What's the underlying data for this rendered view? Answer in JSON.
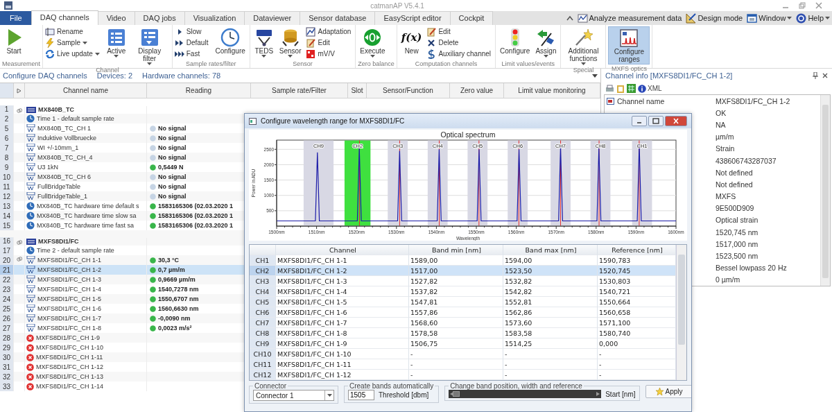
{
  "window": {
    "title": "catmanAP V5.4.1"
  },
  "tabs": [
    {
      "label": "File",
      "kind": "file",
      "selected": false
    },
    {
      "label": "DAQ channels",
      "kind": "tab",
      "selected": true
    },
    {
      "label": "Video",
      "kind": "tab",
      "selected": false
    },
    {
      "label": "DAQ jobs",
      "kind": "tab",
      "selected": false
    },
    {
      "label": "Visualization",
      "kind": "tab",
      "selected": false
    },
    {
      "label": "Dataviewer",
      "kind": "tab",
      "selected": false
    },
    {
      "label": "Sensor database",
      "kind": "tab",
      "selected": false
    },
    {
      "label": "EasyScript editor",
      "kind": "tab",
      "selected": false
    },
    {
      "label": "Cockpit",
      "kind": "tab",
      "selected": false
    }
  ],
  "quick_commands": [
    {
      "label": "Analyze measurement data",
      "dropdown": false
    },
    {
      "label": "Design mode",
      "dropdown": false
    },
    {
      "label": "Window",
      "dropdown": true
    },
    {
      "label": "Help",
      "dropdown": true
    }
  ],
  "ribbon": {
    "groups": [
      {
        "label": "Measurement",
        "columns": [
          {
            "kind": "large",
            "items": [
              {
                "label": "Start",
                "dropdown": false,
                "selected": false
              }
            ]
          }
        ]
      },
      {
        "label": "Channel",
        "columns": [
          {
            "kind": "small",
            "items": [
              {
                "label": "Rename",
                "dropdown": false
              },
              {
                "label": "Sample",
                "dropdown": true
              },
              {
                "label": "Live update",
                "dropdown": true
              }
            ]
          },
          {
            "kind": "large",
            "items": [
              {
                "label": "Active",
                "dropdown": true,
                "selected": false
              },
              {
                "label": "Display filter",
                "dropdown": true,
                "selected": false
              }
            ]
          }
        ]
      },
      {
        "label": "Sample rates/filter",
        "columns": [
          {
            "kind": "small",
            "items": [
              {
                "label": "Slow",
                "dropdown": false
              },
              {
                "label": "Default",
                "dropdown": false
              },
              {
                "label": "Fast",
                "dropdown": false
              }
            ]
          },
          {
            "kind": "large",
            "items": [
              {
                "label": "Configure",
                "dropdown": false,
                "selected": false
              }
            ]
          }
        ]
      },
      {
        "label": "Sensor",
        "columns": [
          {
            "kind": "large",
            "items": [
              {
                "label": "TEDS",
                "dropdown": true,
                "selected": false
              },
              {
                "label": "Sensor",
                "dropdown": true,
                "selected": false
              }
            ]
          },
          {
            "kind": "small",
            "items": [
              {
                "label": "Adaptation",
                "dropdown": false
              },
              {
                "label": "Edit",
                "dropdown": false
              },
              {
                "label": "mV/V",
                "dropdown": false
              }
            ]
          }
        ]
      },
      {
        "label": "Zero balance",
        "columns": [
          {
            "kind": "large",
            "items": [
              {
                "label": "Execute",
                "dropdown": true,
                "selected": false
              }
            ]
          }
        ]
      },
      {
        "label": "Computation channels",
        "columns": [
          {
            "kind": "large",
            "items": [
              {
                "label": "New",
                "icon_text": "f(x)",
                "dropdown": false,
                "selected": false
              }
            ]
          },
          {
            "kind": "small",
            "items": [
              {
                "label": "Edit",
                "dropdown": false
              },
              {
                "label": "Delete",
                "dropdown": false
              },
              {
                "label": "Auxiliary channel",
                "dropdown": false
              }
            ]
          }
        ]
      },
      {
        "label": "Limit values/events",
        "columns": [
          {
            "kind": "large",
            "items": [
              {
                "label": "Configure",
                "dropdown": false,
                "selected": false
              },
              {
                "label": "Assign",
                "dropdown": true,
                "selected": false
              }
            ]
          }
        ]
      },
      {
        "label": "Special",
        "columns": [
          {
            "kind": "large",
            "items": [
              {
                "label": "Additional functions",
                "dropdown": true,
                "selected": false
              }
            ]
          }
        ]
      },
      {
        "label": "MXFS optics",
        "columns": [
          {
            "kind": "large",
            "items": [
              {
                "label": "Configure ranges",
                "dropdown": false,
                "selected": true
              }
            ]
          }
        ]
      }
    ]
  },
  "status_line": {
    "title": "Configure DAQ channels",
    "devices": "Devices: 2",
    "hardware_channels": "Hardware channels: 78"
  },
  "channel_table": {
    "columns": [
      "Channel name",
      "Reading",
      "Sample rate/Filter",
      "Slot",
      "Sensor/Function",
      "Zero value",
      "Limit value monitoring"
    ],
    "rows": [
      {
        "number": "1",
        "kind": "device",
        "name": "MX840B_TC",
        "linked": true,
        "selected": false
      },
      {
        "number": "2",
        "kind": "time",
        "name": "Time 1 - default sample rate",
        "linked": false,
        "selected": false
      },
      {
        "number": "5",
        "kind": "channel",
        "name": "MX840B_TC_CH 1",
        "color": "#c6d4e4",
        "reading": "No signal",
        "linked": false,
        "selected": false
      },
      {
        "number": "6",
        "kind": "channel",
        "name": "Induktive Vollbruecke",
        "color": "#c6d4e4",
        "reading": "No signal",
        "linked": false,
        "selected": false
      },
      {
        "number": "7",
        "kind": "channel",
        "name": "WI +/-10mm_1",
        "color": "#c6d4e4",
        "reading": "No signal",
        "linked": false,
        "selected": false
      },
      {
        "number": "8",
        "kind": "channel",
        "name": "MX840B_TC_CH_4",
        "color": "#c6d4e4",
        "reading": "No signal",
        "linked": false,
        "selected": false
      },
      {
        "number": "9",
        "kind": "channel",
        "name": "U3 1kN",
        "color": "#39b54a",
        "reading": "0,5449 N",
        "linked": false,
        "selected": false
      },
      {
        "number": "10",
        "kind": "channel",
        "name": "MX840B_TC_CH 6",
        "color": "#c6d4e4",
        "reading": "No signal",
        "linked": false,
        "selected": false
      },
      {
        "number": "11",
        "kind": "channel",
        "name": "FullBridgeTable",
        "color": "#c6d4e4",
        "reading": "No signal",
        "linked": false,
        "selected": false
      },
      {
        "number": "12",
        "kind": "channel",
        "name": "FullBridgeTable_1",
        "color": "#c6d4e4",
        "reading": "No signal",
        "linked": false,
        "selected": false
      },
      {
        "number": "13",
        "kind": "time",
        "name": "MX840B_TC hardware time default s",
        "color": "#39b54a",
        "reading": "1583165306 (02.03.2020 1",
        "linked": false,
        "selected": false
      },
      {
        "number": "14",
        "kind": "time",
        "name": "MX840B_TC hardware time slow sa",
        "color": "#39b54a",
        "reading": "1583165306 (02.03.2020 1",
        "linked": false,
        "selected": false
      },
      {
        "number": "15",
        "kind": "time",
        "name": "MX840B_TC hardware time fast sa",
        "color": "#39b54a",
        "reading": "1583165306 (02.03.2020 1",
        "linked": false,
        "selected": false
      },
      {
        "number": "16",
        "kind": "device",
        "name": "MXFS8DI1/FC",
        "linked": true,
        "selected": false
      },
      {
        "number": "17",
        "kind": "time",
        "name": "Time 2 - default sample rate",
        "linked": false,
        "selected": false
      },
      {
        "number": "20",
        "kind": "channel",
        "name": "MXFS8DI1/FC_CH 1-1",
        "color": "#39b54a",
        "reading": "30,3 °C",
        "linked": true,
        "selected": false
      },
      {
        "number": "21",
        "kind": "channel",
        "name": "MXFS8DI1/FC_CH 1-2",
        "color": "#39b54a",
        "reading": "0,7 µm/m",
        "linked": false,
        "selected": true
      },
      {
        "number": "22",
        "kind": "channel",
        "name": "MXFS8DI1/FC_CH 1-3",
        "color": "#39b54a",
        "reading": "0,9669 µm/m",
        "linked": false,
        "selected": false
      },
      {
        "number": "23",
        "kind": "channel",
        "name": "MXFS8DI1/FC_CH 1-4",
        "color": "#39b54a",
        "reading": "1540,7278 nm",
        "linked": false,
        "selected": false
      },
      {
        "number": "24",
        "kind": "channel",
        "name": "MXFS8DI1/FC_CH 1-5",
        "color": "#39b54a",
        "reading": "1550,6707 nm",
        "linked": false,
        "selected": false
      },
      {
        "number": "25",
        "kind": "channel",
        "name": "MXFS8DI1/FC_CH 1-6",
        "color": "#39b54a",
        "reading": "1560,6630 nm",
        "linked": false,
        "selected": false
      },
      {
        "number": "26",
        "kind": "channel",
        "name": "MXFS8DI1/FC_CH 1-7",
        "color": "#39b54a",
        "reading": "-0,0090 nm",
        "linked": false,
        "selected": false
      },
      {
        "number": "27",
        "kind": "channel",
        "name": "MXFS8DI1/FC_CH 1-8",
        "color": "#39b54a",
        "reading": "0,0023 m/s²",
        "linked": false,
        "selected": false
      },
      {
        "number": "28",
        "kind": "error",
        "name": "MXFS8DI1/FC_CH 1-9",
        "linked": false,
        "selected": false
      },
      {
        "number": "29",
        "kind": "error",
        "name": "MXFS8DI1/FC_CH 1-10",
        "linked": false,
        "selected": false
      },
      {
        "number": "30",
        "kind": "error",
        "name": "MXFS8DI1/FC_CH 1-11",
        "linked": false,
        "selected": false
      },
      {
        "number": "31",
        "kind": "error",
        "name": "MXFS8DI1/FC_CH 1-12",
        "linked": false,
        "selected": false
      },
      {
        "number": "32",
        "kind": "error",
        "name": "MXFS8DI1/FC_CH 1-13",
        "linked": false,
        "selected": false
      },
      {
        "number": "33",
        "kind": "error",
        "name": "MXFS8DI1/FC_CH 1-14",
        "linked": false,
        "selected": false
      }
    ]
  },
  "info_panel": {
    "title": "Channel info [MXFS8DI1/FC_CH 1-2]",
    "toolbar_label": "XML",
    "properties": [
      {
        "label": "Channel name",
        "value": "MXFS8DI1/FC_CH 1-2"
      },
      {
        "value": "OK"
      },
      {
        "value": "NA"
      },
      {
        "value": "µm/m"
      },
      {
        "value": "Strain"
      },
      {
        "value": "438606743287037"
      },
      {
        "value": "Not defined"
      },
      {
        "value": "Not defined"
      },
      {
        "value": "MXFS"
      },
      {
        "value": "9E500D909"
      },
      {
        "value": "Optical strain"
      },
      {
        "value": "1520,745 nm"
      },
      {
        "value": "1517,000 nm"
      },
      {
        "value": "1523,500 nm"
      },
      {
        "value": "Bessel lowpass 20 Hz"
      },
      {
        "value": "0 µm/m"
      }
    ]
  },
  "dialog": {
    "title": "Configure wavelength range for MXFS8DI1/FC",
    "chart_data": {
      "type": "line",
      "title": "Optical spectrum",
      "xlabel": "Wavelength",
      "ylabel": "Power in ADU",
      "xlim": [
        1500,
        1600
      ],
      "ylim": [
        0,
        2800
      ],
      "grid": true,
      "xticks": [
        {
          "value": 1500,
          "label": "1500nm"
        },
        {
          "value": 1510,
          "label": "1510nm"
        },
        {
          "value": 1520,
          "label": "1520nm"
        },
        {
          "value": 1530,
          "label": "1530nm"
        },
        {
          "value": 1540,
          "label": "1540nm"
        },
        {
          "value": 1550,
          "label": "1550nm"
        },
        {
          "value": 1560,
          "label": "1560nm"
        },
        {
          "value": 1570,
          "label": "1570nm"
        },
        {
          "value": 1580,
          "label": "1580nm"
        },
        {
          "value": 1590,
          "label": "1590nm"
        },
        {
          "value": 1600,
          "label": "1600nm"
        }
      ],
      "yticks": [
        500,
        1000,
        1500,
        2000,
        2500
      ],
      "x": [
        1500,
        1509.7,
        1510.2,
        1510.7,
        1520.2,
        1520.7,
        1521.2,
        1530.3,
        1530.8,
        1531.3,
        1540.2,
        1540.7,
        1541.2,
        1550.2,
        1550.7,
        1551.2,
        1560.2,
        1560.7,
        1561.2,
        1570.6,
        1571.1,
        1571.6,
        1580.2,
        1580.7,
        1581.2,
        1590.3,
        1590.8,
        1591.3,
        1600
      ],
      "series": [
        {
          "color": "#1c1ca8",
          "values": [
            170,
            170,
            2400,
            170,
            170,
            2550,
            170,
            170,
            2450,
            170,
            170,
            2500,
            170,
            170,
            2500,
            170,
            170,
            2500,
            170,
            170,
            2600,
            170,
            170,
            2550,
            170,
            170,
            2650,
            170,
            170
          ]
        }
      ],
      "bands": [
        {
          "axis": "x",
          "from": 1506.75,
          "to": 1514.25,
          "label": "CH9",
          "color": "#d8d8e4"
        },
        {
          "axis": "x",
          "from": 1517,
          "to": 1523.5,
          "label": "CH2",
          "color": "#3fe03f"
        },
        {
          "axis": "x",
          "from": 1527.82,
          "to": 1532.82,
          "label": "CH3",
          "color": "#d8d8e4"
        },
        {
          "axis": "x",
          "from": 1537.82,
          "to": 1542.82,
          "label": "CH4",
          "color": "#d8d8e4"
        },
        {
          "axis": "x",
          "from": 1547.81,
          "to": 1552.81,
          "label": "CH5",
          "color": "#d8d8e4"
        },
        {
          "axis": "x",
          "from": 1557.86,
          "to": 1562.86,
          "label": "CH6",
          "color": "#d8d8e4"
        },
        {
          "axis": "x",
          "from": 1568.6,
          "to": 1573.6,
          "label": "CH7",
          "color": "#d8d8e4"
        },
        {
          "axis": "x",
          "from": 1578.58,
          "to": 1583.58,
          "label": "CH8",
          "color": "#d8d8e4"
        },
        {
          "axis": "x",
          "from": 1589,
          "to": 1594,
          "label": "CH1",
          "color": "#d8d8e4"
        }
      ],
      "ref_lines": [
        {
          "axis": "x",
          "value": 1520.745,
          "color": "#e03030"
        },
        {
          "axis": "x",
          "value": 1530.803,
          "color": "#e03030"
        },
        {
          "axis": "x",
          "value": 1540.721,
          "color": "#e03030"
        },
        {
          "axis": "x",
          "value": 1550.664,
          "color": "#e03030"
        },
        {
          "axis": "x",
          "value": 1560.658,
          "color": "#e03030"
        },
        {
          "axis": "x",
          "value": 1571.1,
          "color": "#e03030"
        },
        {
          "axis": "x",
          "value": 1580.74,
          "color": "#e03030"
        },
        {
          "axis": "x",
          "value": 1590.783,
          "color": "#e03030"
        }
      ]
    },
    "band_table": {
      "columns": [
        "Channel",
        "Band min [nm]",
        "Band max [nm]",
        "Reference [nm]"
      ],
      "rows": [
        {
          "header": "CH1",
          "cells": [
            "MXFS8DI1/FC_CH 1-1",
            "1589,00",
            "1594,00",
            "1590,783"
          ],
          "selected": false
        },
        {
          "header": "CH2",
          "cells": [
            "MXFS8DI1/FC_CH 1-2",
            "1517,00",
            "1523,50",
            "1520,745"
          ],
          "selected": true
        },
        {
          "header": "CH3",
          "cells": [
            "MXFS8DI1/FC_CH 1-3",
            "1527,82",
            "1532,82",
            "1530,803"
          ],
          "selected": false
        },
        {
          "header": "CH4",
          "cells": [
            "MXFS8DI1/FC_CH 1-4",
            "1537,82",
            "1542,82",
            "1540,721"
          ],
          "selected": false
        },
        {
          "header": "CH5",
          "cells": [
            "MXFS8DI1/FC_CH 1-5",
            "1547,81",
            "1552,81",
            "1550,664"
          ],
          "selected": false
        },
        {
          "header": "CH6",
          "cells": [
            "MXFS8DI1/FC_CH 1-6",
            "1557,86",
            "1562,86",
            "1560,658"
          ],
          "selected": false
        },
        {
          "header": "CH7",
          "cells": [
            "MXFS8DI1/FC_CH 1-7",
            "1568,60",
            "1573,60",
            "1571,100"
          ],
          "selected": false
        },
        {
          "header": "CH8",
          "cells": [
            "MXFS8DI1/FC_CH 1-8",
            "1578,58",
            "1583,58",
            "1580,740"
          ],
          "selected": false
        },
        {
          "header": "CH9",
          "cells": [
            "MXFS8DI1/FC_CH 1-9",
            "1506,75",
            "1514,25",
            "0,000"
          ],
          "selected": false
        },
        {
          "header": "CH10",
          "cells": [
            "MXFS8DI1/FC_CH 1-10",
            "-",
            "-",
            "-"
          ],
          "selected": false
        },
        {
          "header": "CH11",
          "cells": [
            "MXFS8DI1/FC_CH 1-11",
            "-",
            "-",
            "-"
          ],
          "selected": false
        },
        {
          "header": "CH12",
          "cells": [
            "MXFS8DI1/FC_CH 1-12",
            "-",
            "-",
            "-"
          ],
          "selected": false
        }
      ]
    },
    "connector": {
      "legend": "Connector",
      "value": "Connector 1"
    },
    "auto_bands": {
      "legend": "Create bands automatically",
      "threshold": "1505",
      "threshold_label": "Threshold [dbm]"
    },
    "band_adjust": {
      "legend": "Change band position, width and reference",
      "level": 0.05,
      "label": "Start [nm]"
    },
    "apply_button": {
      "label": "Apply"
    }
  }
}
